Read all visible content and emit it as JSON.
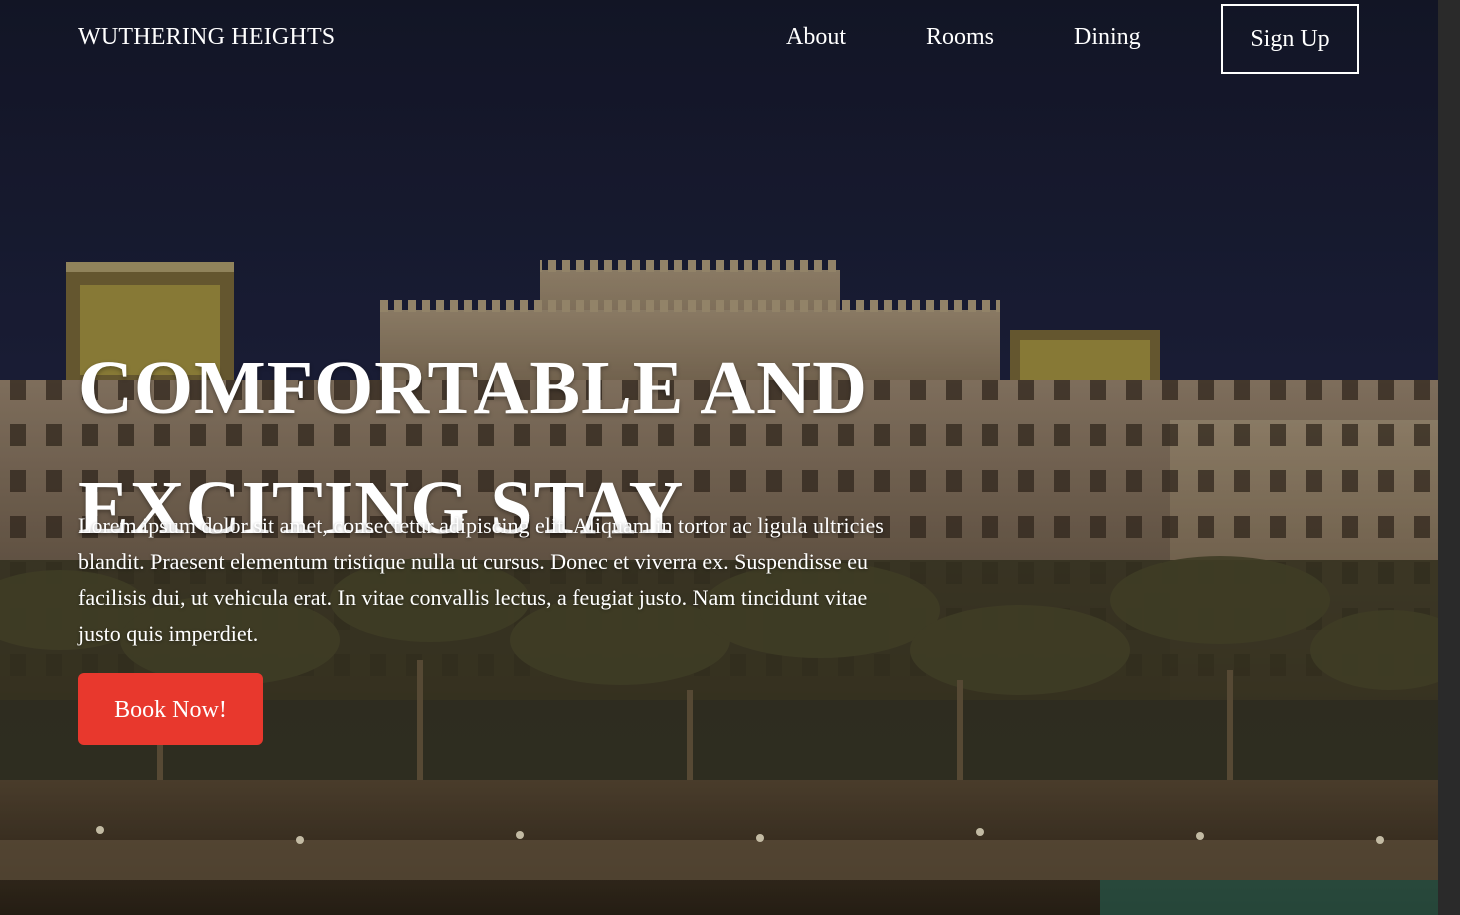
{
  "nav": {
    "brand": "WUTHERING HEIGHTS",
    "links": [
      "About",
      "Rooms",
      "Dining"
    ],
    "signup_label": "Sign Up"
  },
  "hero": {
    "title": "COMFORTABLE AND EXCITING STAY",
    "text": "Lorem ipsum dolor sit amet, consectetur adipiscing elit. Aliquam in tortor ac ligula ultricies blandit. Praesent elementum tristique nulla ut cursus. Donec et viverra ex. Suspendisse eu facilisis dui, ut vehicula erat. In vitae convallis lectus, a feugiat justo. Nam tincidunt vitae justo quis imperdiet.",
    "cta_label": "Book Now!",
    "background": "hotel-at-night-photo"
  },
  "colors": {
    "sky": "#1b1f33",
    "cta": "#e8382d",
    "text": "#ffffff"
  }
}
